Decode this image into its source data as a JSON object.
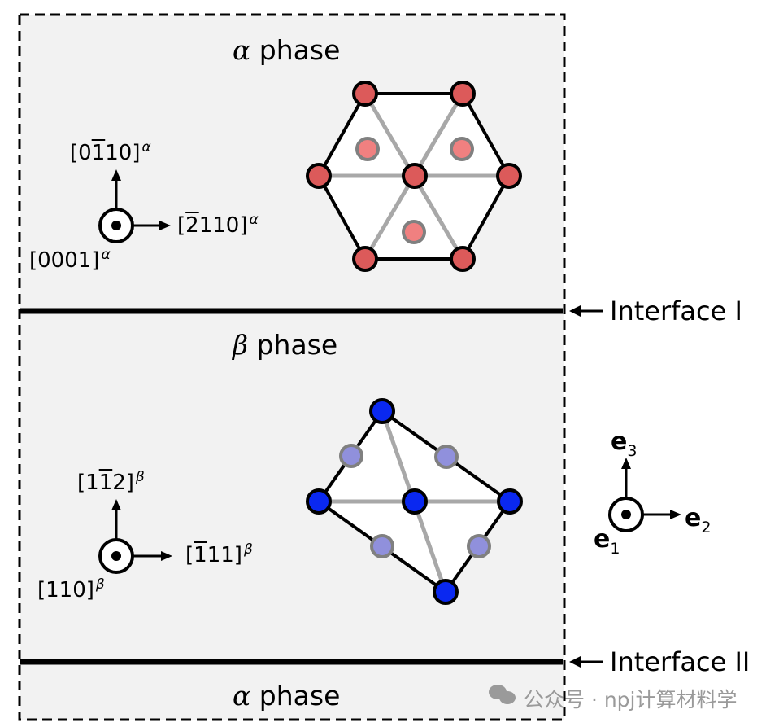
{
  "regions": [
    {
      "symbol": "α",
      "label": "phase"
    },
    {
      "symbol": "β",
      "label": "phase"
    },
    {
      "symbol": "α",
      "label": "phase"
    }
  ],
  "interfaces": [
    "Interface I",
    "Interface II"
  ],
  "alpha_axes": {
    "up": {
      "pre": "[0",
      "bar": "1",
      "post": "10]",
      "sup": "α"
    },
    "right": {
      "pre": "[",
      "bar": "2",
      "post": "110]",
      "sup": "α"
    },
    "out": {
      "pre": "[0001]",
      "bar": "",
      "post": "",
      "sup": "α"
    }
  },
  "beta_axes": {
    "up": {
      "pre": "[1",
      "bar": "1",
      "post": "2]",
      "sup": "β"
    },
    "right": {
      "pre": "[",
      "bar": "1",
      "post": "11]",
      "sup": "β"
    },
    "out": {
      "pre": "[110]",
      "bar": "",
      "post": "",
      "sup": "β"
    }
  },
  "frame_axes": {
    "up": {
      "base": "e",
      "sub": "3"
    },
    "right": {
      "base": "e",
      "sub": "2"
    },
    "out": {
      "base": "e",
      "sub": "1"
    }
  },
  "colors": {
    "background": "#f2f2f2",
    "alpha_atom": "#dc5a5a",
    "alpha_atom_inner": "#f08080",
    "beta_atom": "#0a28f0",
    "beta_atom_inner": "#9090dc",
    "gray_line": "#a8a8a8"
  },
  "watermark": "公众号 · npj计算材料学"
}
